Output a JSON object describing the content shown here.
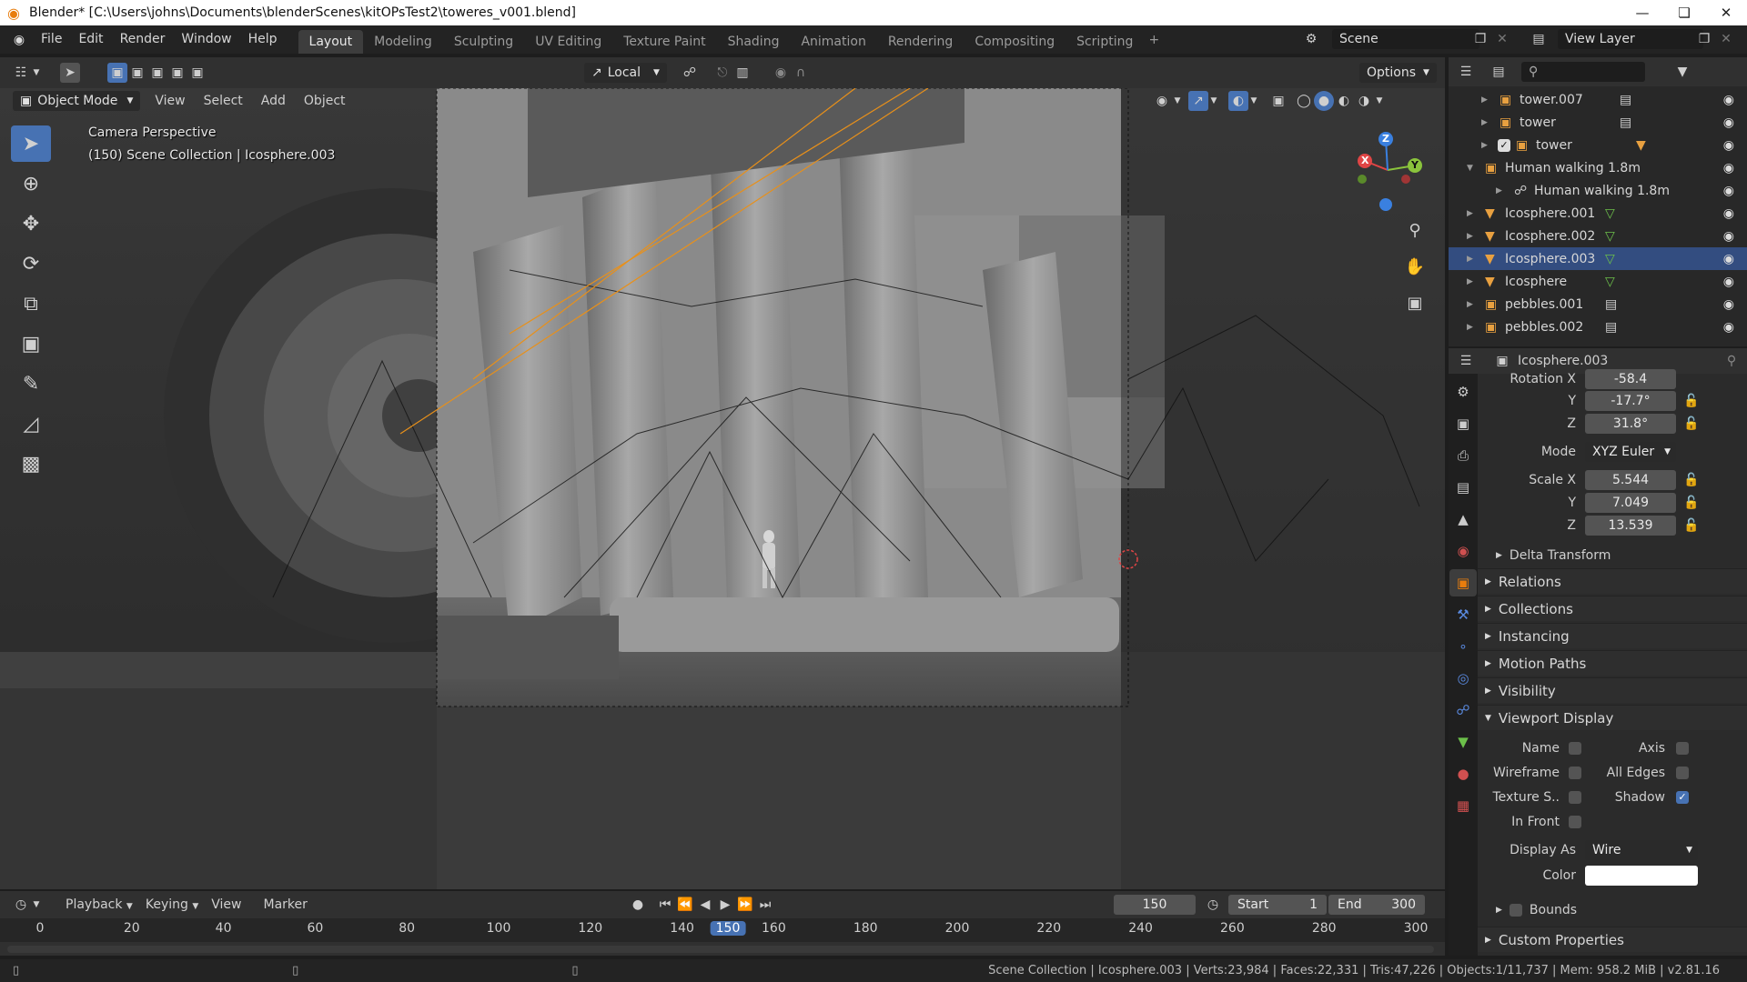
{
  "window": {
    "title": "Blender* [C:\\Users\\johns\\Documents\\blenderScenes\\kitOPsTest2\\toweres_v001.blend]"
  },
  "menus": [
    "File",
    "Edit",
    "Render",
    "Window",
    "Help"
  ],
  "workspaces": [
    "Layout",
    "Modeling",
    "Sculpting",
    "UV Editing",
    "Texture Paint",
    "Shading",
    "Animation",
    "Rendering",
    "Compositing",
    "Scripting"
  ],
  "active_workspace": "Layout",
  "scene": "Scene",
  "view_layer": "View Layer",
  "viewport_header": {
    "transform_orientation": "Local",
    "options": "Options"
  },
  "viewport_menu": {
    "mode": "Object Mode",
    "items": [
      "View",
      "Select",
      "Add",
      "Object"
    ]
  },
  "viewport_info": {
    "line1": "Camera Perspective",
    "line2": "(150) Scene Collection | Icosphere.003"
  },
  "gizmo": {
    "x": "X",
    "y": "Y",
    "z": "Z",
    "x_color": "#e04545",
    "y_color": "#8ac33c",
    "z_color": "#3a80e0"
  },
  "outliner": [
    {
      "name": "tower.007",
      "icon": "collection-icon",
      "extra": "collection-box-icon",
      "selected": false,
      "checked": false
    },
    {
      "name": "tower",
      "icon": "collection-icon",
      "extra": "collection-box-icon",
      "selected": false,
      "checked": false
    },
    {
      "name": "tower",
      "icon": "collection-icon",
      "extra": "mesh-icon",
      "selected": false,
      "checked": true
    },
    {
      "name": "Human walking 1.8m",
      "icon": "collection-icon",
      "extra": "",
      "selected": false,
      "checked": false
    },
    {
      "name": "Human walking 1.8m",
      "icon": "link-icon",
      "extra": "",
      "selected": false,
      "checked": false
    },
    {
      "name": "Icosphere.001",
      "icon": "mesh-icon",
      "extra": "mesh-data-icon",
      "selected": false,
      "checked": false
    },
    {
      "name": "Icosphere.002",
      "icon": "mesh-icon",
      "extra": "mesh-data-icon",
      "selected": false,
      "checked": false
    },
    {
      "name": "Icosphere.003",
      "icon": "mesh-icon",
      "extra": "mesh-data-icon",
      "selected": true,
      "checked": false
    },
    {
      "name": "Icosphere",
      "icon": "mesh-icon",
      "extra": "mesh-data-icon",
      "selected": false,
      "checked": false
    },
    {
      "name": "pebbles.001",
      "icon": "collection-icon",
      "extra": "collection-box-icon",
      "selected": false,
      "checked": false
    },
    {
      "name": "pebbles.002",
      "icon": "collection-icon",
      "extra": "collection-box-icon",
      "selected": false,
      "checked": false
    }
  ],
  "properties": {
    "object_name": "Icosphere.003",
    "rotation": {
      "label_x": "Rotation X",
      "x": "-58.4",
      "label_y": "Y",
      "y": "-17.7°",
      "label_z": "Z",
      "z": "31.8°"
    },
    "mode_label": "Mode",
    "mode_value": "XYZ Euler",
    "scale": {
      "label_x": "Scale X",
      "x": "5.544",
      "label_y": "Y",
      "y": "7.049",
      "label_z": "Z",
      "z": "13.539"
    },
    "delta_transform": "Delta Transform",
    "panels": [
      "Relations",
      "Collections",
      "Instancing",
      "Motion Paths",
      "Visibility"
    ],
    "viewport_display": {
      "title": "Viewport Display",
      "name": "Name",
      "axis": "Axis",
      "wireframe": "Wireframe",
      "all_edges": "All Edges",
      "texture_space": "Texture S..",
      "shadow": "Shadow",
      "in_front": "In Front",
      "display_as_label": "Display As",
      "display_as_value": "Wire",
      "color_label": "Color",
      "bounds": "Bounds"
    },
    "custom_properties": "Custom Properties"
  },
  "timeline": {
    "menus": [
      "Playback",
      "Keying",
      "View",
      "Marker"
    ],
    "current_frame": "150",
    "start_label": "Start",
    "start": "1",
    "end_label": "End",
    "end": "300",
    "ticks": [
      "0",
      "20",
      "40",
      "60",
      "80",
      "100",
      "120",
      "140",
      "150",
      "160",
      "180",
      "200",
      "220",
      "240",
      "260",
      "280",
      "300"
    ]
  },
  "statusbar": "Scene Collection | Icosphere.003 | Verts:23,984 | Faces:22,331 | Tris:47,226 | Objects:1/11,737 | Mem: 958.2 MiB | v2.81.16"
}
